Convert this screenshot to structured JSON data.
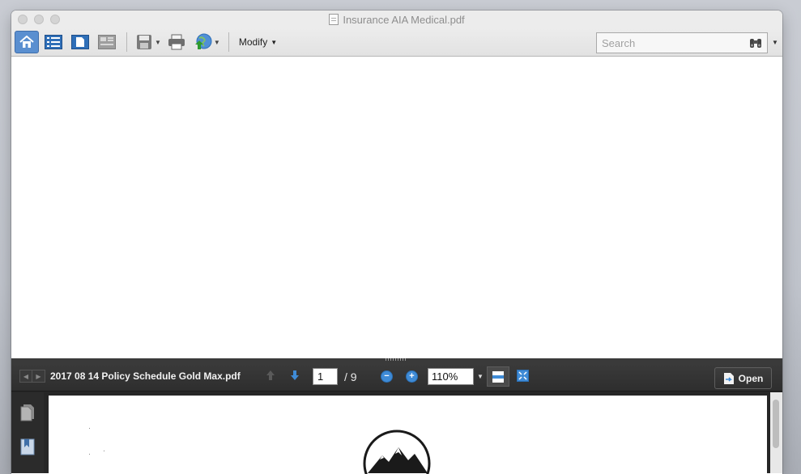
{
  "window": {
    "title": "Insurance AIA Medical.pdf"
  },
  "toolbar": {
    "buttons": [
      {
        "name": "home-icon",
        "active": true
      },
      {
        "name": "list-view-icon",
        "active": false
      },
      {
        "name": "page-view-icon",
        "active": false
      },
      {
        "name": "card-view-icon",
        "active": false
      },
      {
        "name": "save-icon",
        "active": false
      },
      {
        "name": "print-icon",
        "active": false
      },
      {
        "name": "share-icon",
        "active": false
      }
    ],
    "modify_label": "Modify",
    "search_placeholder": "Search"
  },
  "viewer": {
    "file_name": "2017 08 14 Policy Schedule Gold Max.pdf",
    "current_page": "1",
    "page_total": "/ 9",
    "zoom": "110%",
    "zoom_minus": "−",
    "zoom_plus": "+",
    "open_label": "Open"
  },
  "colors": {
    "active_button": "#5a8fd0",
    "viewer_bar": "#2e2e2e",
    "accent_blue": "#3f8bd6"
  }
}
